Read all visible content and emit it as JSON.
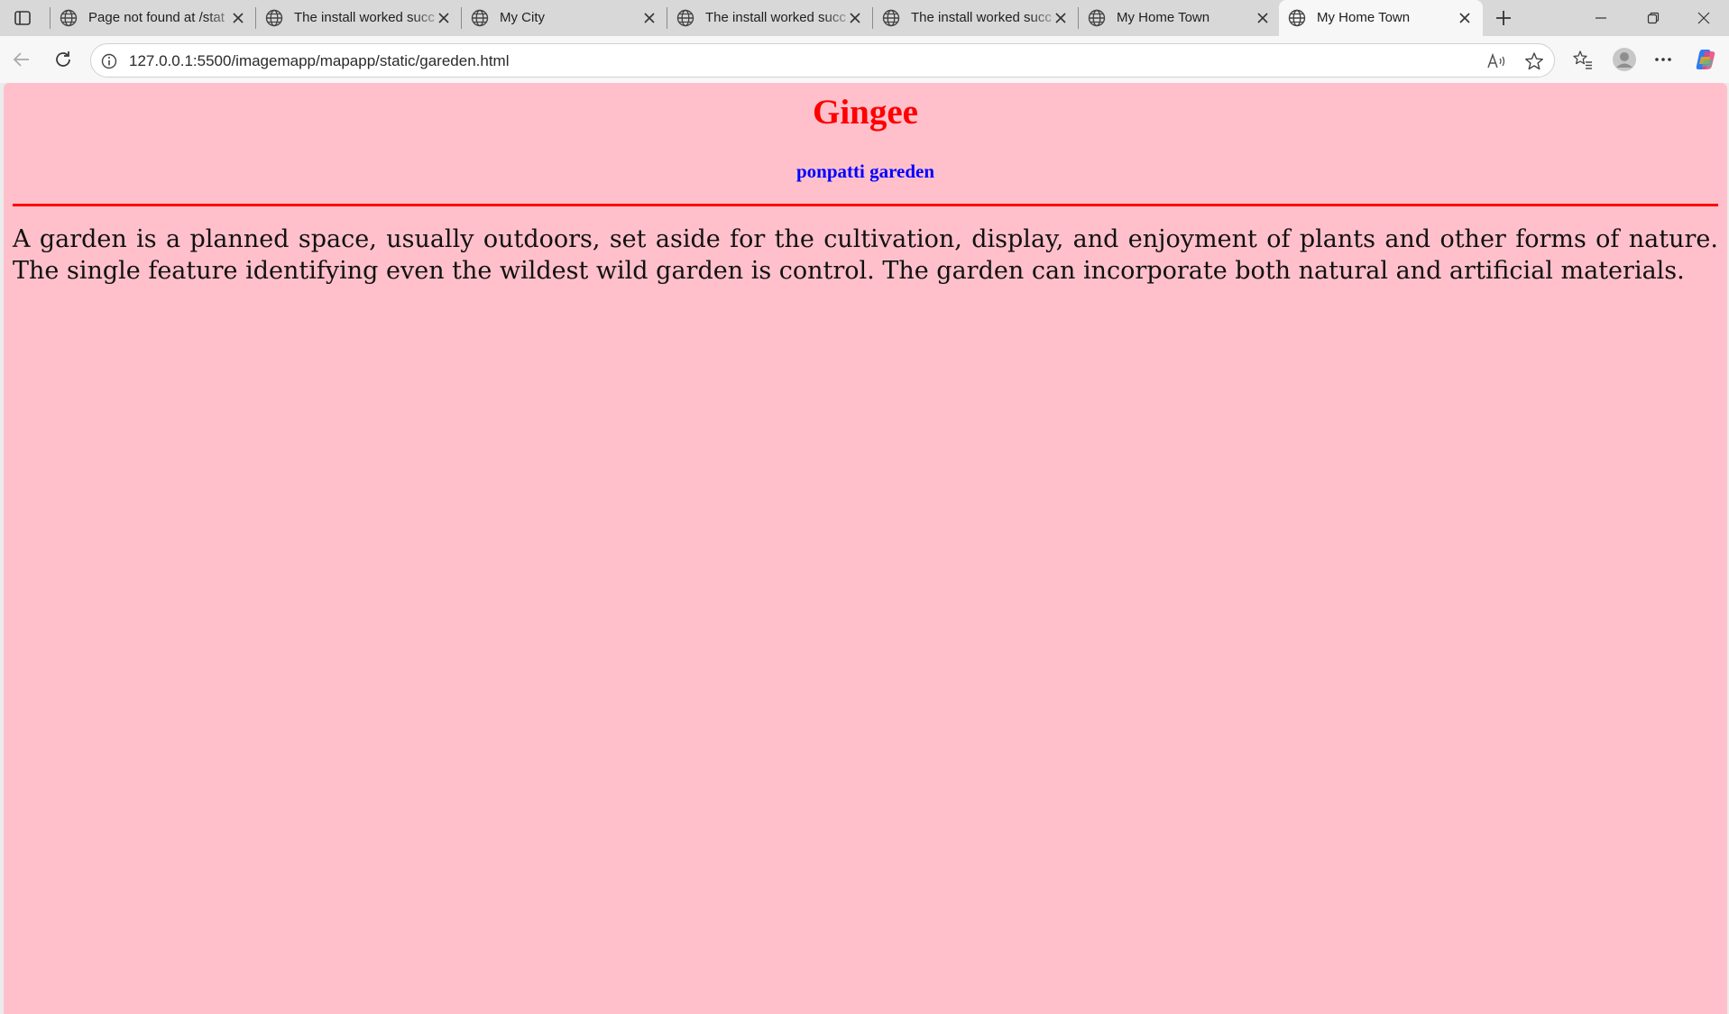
{
  "tabs": [
    {
      "title": "Page not found at /stat",
      "active": false
    },
    {
      "title": "The install worked succ",
      "active": false
    },
    {
      "title": "My City",
      "active": false
    },
    {
      "title": "The install worked succ",
      "active": false
    },
    {
      "title": "The install worked succ",
      "active": false
    },
    {
      "title": "My Home Town",
      "active": false
    },
    {
      "title": "My Home Town",
      "active": true
    }
  ],
  "address_bar": {
    "url": "127.0.0.1:5500/imagemapp/mapapp/static/gareden.html"
  },
  "page": {
    "heading": "Gingee",
    "subheading": "ponpatti gareden",
    "paragraph": "A garden is a planned space, usually outdoors, set aside for the cultivation, display, and enjoyment of plants and other forms of nature. The single feature identifying even the wildest wild garden is control. The garden can incorporate both natural and artificial materials."
  },
  "colors": {
    "page_background": "#ffc0cb",
    "heading": "#ff0000",
    "subheading": "#0000ff",
    "rule": "#ff0000"
  },
  "icons": {
    "tab_favicon": "globe-icon",
    "tab_close": "close-icon",
    "new_tab": "plus-icon",
    "back": "arrow-left-icon",
    "refresh": "refresh-icon",
    "site_info": "info-icon",
    "read_aloud": "read-aloud-icon",
    "favorite": "star-icon",
    "favorites": "favorites-icon",
    "profile": "avatar-icon",
    "more": "more-icon",
    "copilot": "copilot-icon"
  }
}
